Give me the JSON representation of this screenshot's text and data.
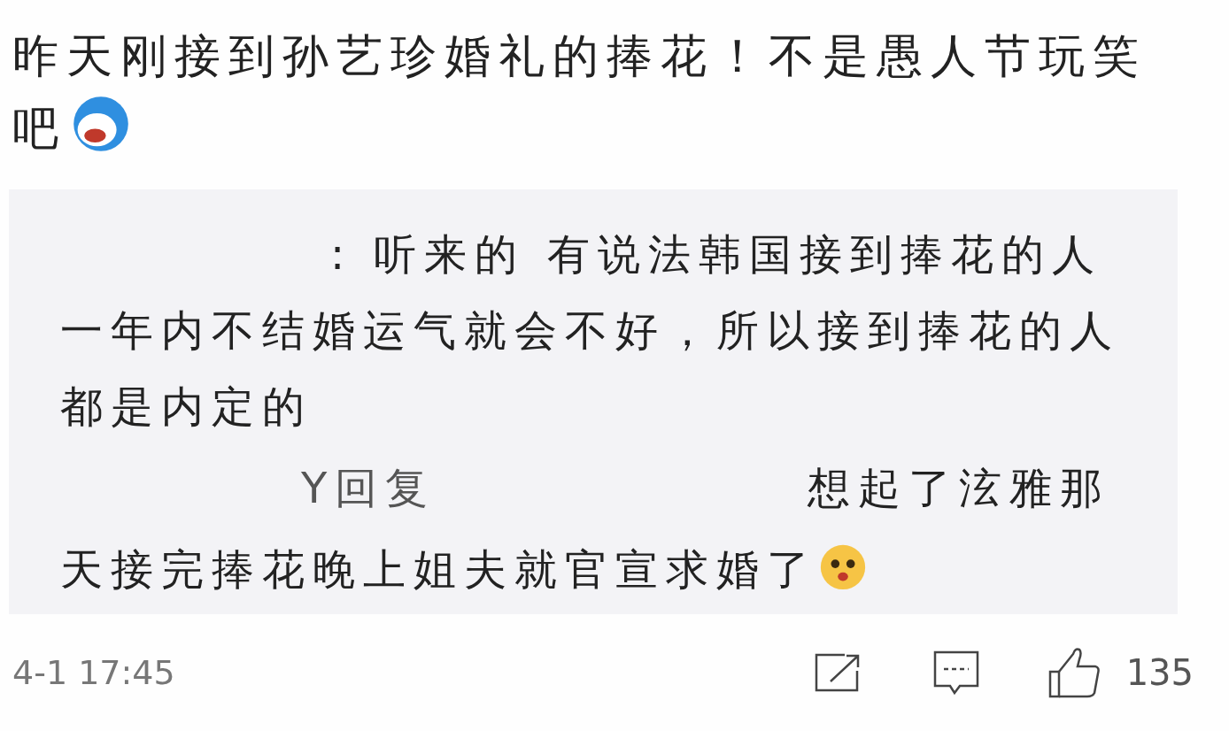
{
  "post": {
    "text": "昨天刚接到孙艺珍婚礼的捧花！不是愚人节玩笑吧"
  },
  "comments": [
    {
      "kind": "comment",
      "text": ": 听来的 有说法韩国接到捧花的人一年内不结婚运气就会不好，所以接到捧花的人都是内定的"
    },
    {
      "kind": "reply",
      "prefix": "Y回复",
      "lines": [
        "想起了泫雅那",
        "天接完捧花晚上姐夫就官宣求婚了"
      ]
    }
  ],
  "footer": {
    "time": "4-1 17:45",
    "likes": "135"
  }
}
